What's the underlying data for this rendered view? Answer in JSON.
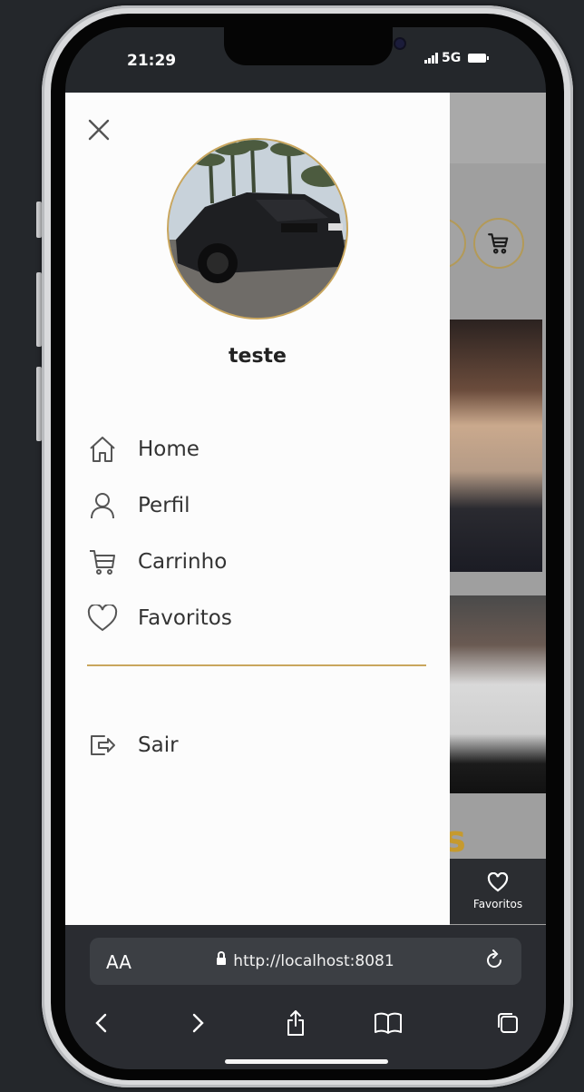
{
  "status": {
    "time": "21:29",
    "network": "5G"
  },
  "drawer": {
    "user_name": "teste",
    "menu": [
      {
        "label": "Home",
        "icon": "home-icon"
      },
      {
        "label": "Perfil",
        "icon": "user-icon"
      },
      {
        "label": "Carrinho",
        "icon": "cart-icon"
      },
      {
        "label": "Favoritos",
        "icon": "heart-icon"
      }
    ],
    "logout_label": "Sair"
  },
  "background_app": {
    "tab_label": "Favoritos",
    "partial_heading": "s"
  },
  "browser": {
    "text_size_label": "AA",
    "url": "http://localhost:8081"
  },
  "colors": {
    "accent": "#c9a65d",
    "drawer_bg": "#fcfcfc",
    "browser_bg": "#2a2c31"
  }
}
